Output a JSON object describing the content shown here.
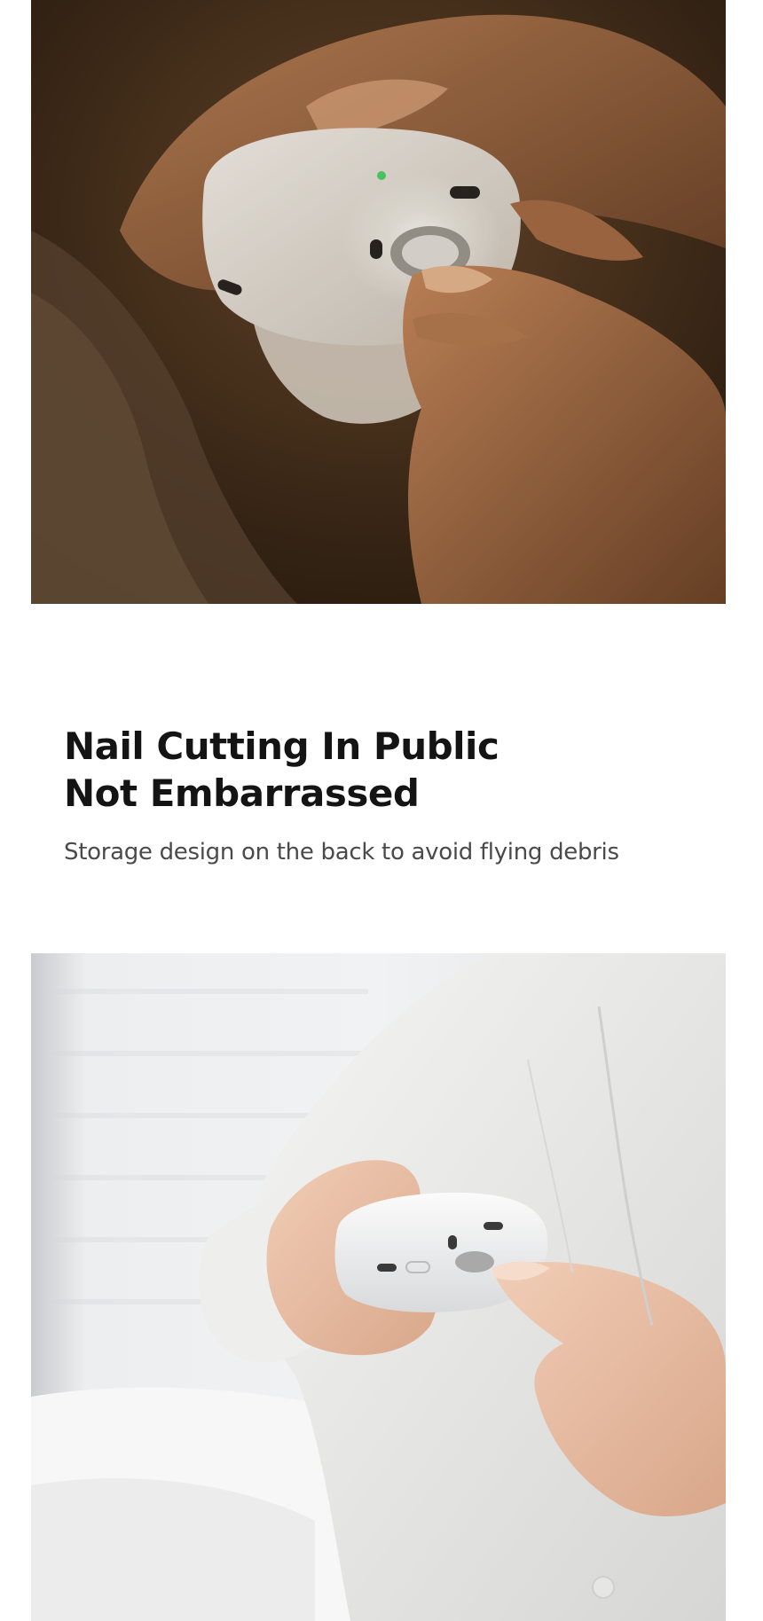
{
  "hero_photo": {
    "subject": "white electric nail clipper with LED light used at night on a child's hand"
  },
  "section": {
    "title_line1": "Nail Cutting In Public",
    "title_line2": "Not Embarrassed",
    "subtitle": "Storage design on the back to avoid flying debris"
  },
  "detail_photo": {
    "subject": "person in white shirt trimming fingernail with white electric nail clipper"
  },
  "colors": {
    "background": "#ffffff",
    "heading": "#141414",
    "body_text": "#4a4a4a"
  }
}
